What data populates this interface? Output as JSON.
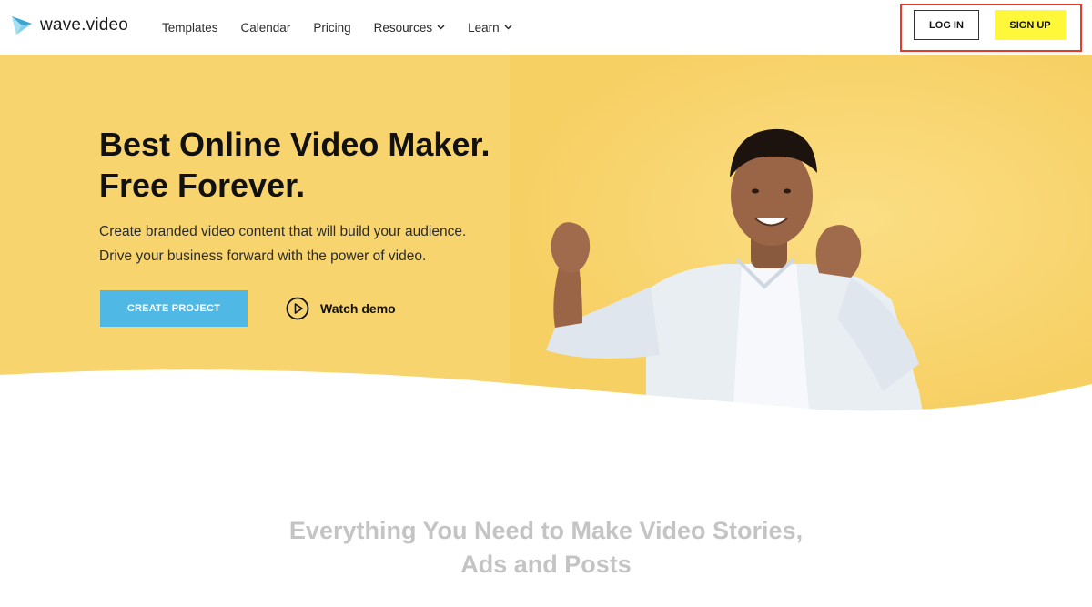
{
  "brand": {
    "name": "wave.video",
    "logo_icon": "wave-video-logo-icon",
    "accent": "#4fb8e4"
  },
  "nav": {
    "items": [
      {
        "label": "Templates",
        "has_dropdown": false
      },
      {
        "label": "Calendar",
        "has_dropdown": false
      },
      {
        "label": "Pricing",
        "has_dropdown": false
      },
      {
        "label": "Resources",
        "has_dropdown": true
      },
      {
        "label": "Learn",
        "has_dropdown": true
      }
    ]
  },
  "auth": {
    "login_label": "LOG IN",
    "signup_label": "SIGN UP",
    "signup_color": "#fff83a",
    "highlight_color": "#e8392b"
  },
  "hero": {
    "title_line1": "Best Online Video Maker.",
    "title_line2": "Free Forever.",
    "subtitle_line1": "Create branded video content that will build your audience.",
    "subtitle_line2": "Drive your business forward with the power of video.",
    "cta_label": "CREATE PROJECT",
    "demo_label": "Watch demo",
    "background_color": "#f8d46e"
  },
  "section": {
    "title_line1": "Everything You Need to Make Video Stories,",
    "title_line2": "Ads and Posts"
  }
}
